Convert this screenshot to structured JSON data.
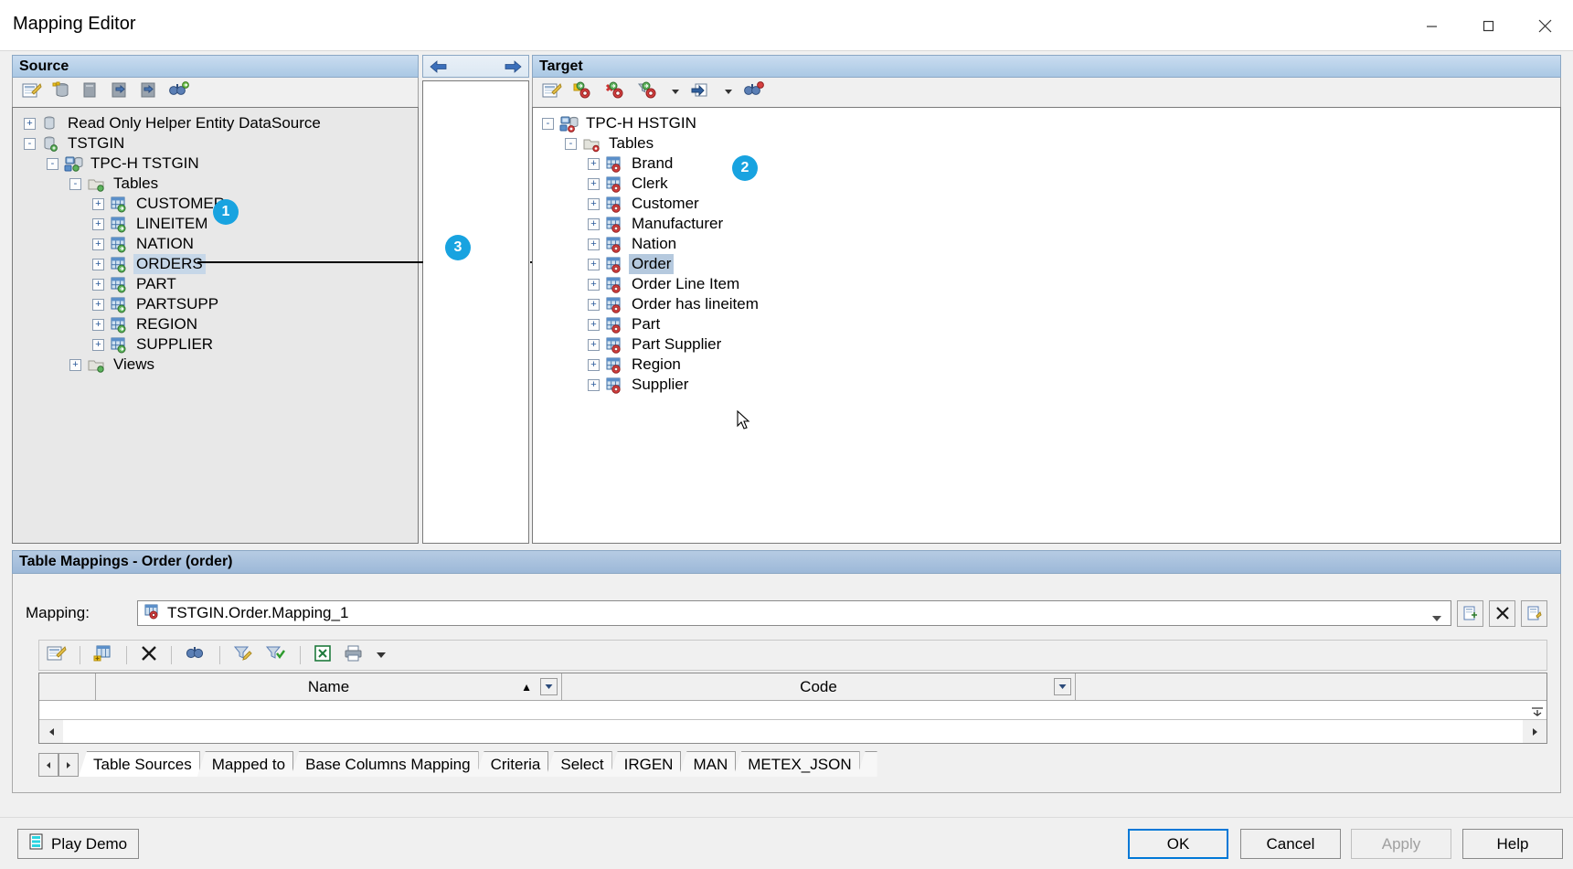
{
  "window": {
    "title": "Mapping Editor",
    "minimize_label": "Minimize",
    "maximize_label": "Maximize",
    "close_label": "Close"
  },
  "source": {
    "header": "Source",
    "badge": "1",
    "toolbar": [
      {
        "name": "open-editor-icon",
        "title": "Edit"
      },
      {
        "name": "add-datasource-icon",
        "title": "Add Data Source"
      },
      {
        "name": "copy-icon",
        "title": "Copy"
      },
      {
        "name": "import-icon",
        "title": "Import"
      },
      {
        "name": "export-icon",
        "title": "Export"
      },
      {
        "name": "find-icon",
        "title": "Find"
      }
    ],
    "tree": [
      {
        "label": "Read Only Helper Entity DataSource",
        "indent": 0,
        "expander": "+",
        "icon": "database-icon",
        "selected": false
      },
      {
        "label": "TSTGIN",
        "indent": 0,
        "expander": "-",
        "icon": "database-add-icon",
        "selected": false
      },
      {
        "label": "TPC-H TSTGIN",
        "indent": 1,
        "expander": "-",
        "icon": "connection-icon",
        "selected": false
      },
      {
        "label": "Tables",
        "indent": 2,
        "expander": "-",
        "icon": "folder-icon",
        "selected": false
      },
      {
        "label": "CUSTOMER",
        "indent": 3,
        "expander": "+",
        "icon": "table-green-icon",
        "selected": false
      },
      {
        "label": "LINEITEM",
        "indent": 3,
        "expander": "+",
        "icon": "table-green-icon",
        "selected": false
      },
      {
        "label": "NATION",
        "indent": 3,
        "expander": "+",
        "icon": "table-green-icon",
        "selected": false
      },
      {
        "label": "ORDERS",
        "indent": 3,
        "expander": "+",
        "icon": "table-green-icon",
        "selected": true
      },
      {
        "label": "PART",
        "indent": 3,
        "expander": "+",
        "icon": "table-green-icon",
        "selected": false
      },
      {
        "label": "PARTSUPP",
        "indent": 3,
        "expander": "+",
        "icon": "table-green-icon",
        "selected": false
      },
      {
        "label": "REGION",
        "indent": 3,
        "expander": "+",
        "icon": "table-green-icon",
        "selected": false
      },
      {
        "label": "SUPPLIER",
        "indent": 3,
        "expander": "+",
        "icon": "table-green-icon",
        "selected": false
      },
      {
        "label": "Views",
        "indent": 2,
        "expander": "+",
        "icon": "folder-icon",
        "selected": false
      }
    ]
  },
  "middle": {
    "badge": "3",
    "left_arrow_label": "Map left",
    "right_arrow_label": "Map right"
  },
  "target": {
    "header": "Target",
    "badge": "2",
    "toolbar": [
      {
        "name": "open-editor-icon",
        "title": "Edit"
      },
      {
        "name": "add-entity-icon",
        "title": "Add Entity"
      },
      {
        "name": "remove-entity-icon",
        "title": "Remove Entity"
      },
      {
        "name": "filter-entity-icon",
        "title": "Filter Entity"
      },
      {
        "name": "import-entity-icon",
        "title": "Import Entity"
      },
      {
        "name": "find-icon",
        "title": "Find"
      }
    ],
    "tree": [
      {
        "label": "TPC-H HSTGIN",
        "indent": 0,
        "expander": "-",
        "icon": "connection-red-icon",
        "selected": false
      },
      {
        "label": "Tables",
        "indent": 1,
        "expander": "-",
        "icon": "folder-red-icon",
        "selected": false
      },
      {
        "label": "Brand",
        "indent": 2,
        "expander": "+",
        "icon": "table-red-icon",
        "selected": false
      },
      {
        "label": "Clerk",
        "indent": 2,
        "expander": "+",
        "icon": "table-red-icon",
        "selected": false
      },
      {
        "label": "Customer",
        "indent": 2,
        "expander": "+",
        "icon": "table-red-icon",
        "selected": false
      },
      {
        "label": "Manufacturer",
        "indent": 2,
        "expander": "+",
        "icon": "table-red-icon",
        "selected": false
      },
      {
        "label": "Nation",
        "indent": 2,
        "expander": "+",
        "icon": "table-red-icon",
        "selected": false
      },
      {
        "label": "Order",
        "indent": 2,
        "expander": "+",
        "icon": "table-red-icon",
        "selected": true
      },
      {
        "label": "Order Line Item",
        "indent": 2,
        "expander": "+",
        "icon": "table-red-icon",
        "selected": false
      },
      {
        "label": "Order has lineitem",
        "indent": 2,
        "expander": "+",
        "icon": "table-red-icon",
        "selected": false
      },
      {
        "label": "Part",
        "indent": 2,
        "expander": "+",
        "icon": "table-red-icon",
        "selected": false
      },
      {
        "label": "Part Supplier",
        "indent": 2,
        "expander": "+",
        "icon": "table-red-icon",
        "selected": false
      },
      {
        "label": "Region",
        "indent": 2,
        "expander": "+",
        "icon": "table-red-icon",
        "selected": false
      },
      {
        "label": "Supplier",
        "indent": 2,
        "expander": "+",
        "icon": "table-red-icon",
        "selected": false
      }
    ]
  },
  "table_mappings": {
    "header": "Table Mappings - Order (order)",
    "mapping_label": "Mapping:",
    "mapping_value": "TSTGIN.Order.Mapping_1",
    "mapping_actions": [
      {
        "name": "new-mapping-button",
        "glyph": "new"
      },
      {
        "name": "delete-mapping-button",
        "glyph": "x"
      },
      {
        "name": "copy-mapping-button",
        "glyph": "copy"
      }
    ],
    "grid_toolbar": [
      {
        "name": "edit-row-icon",
        "title": "Edit"
      },
      {
        "name": "add-row-icon",
        "title": "Add"
      },
      {
        "name": "delete-row-icon",
        "title": "Delete"
      },
      {
        "name": "find-row-icon",
        "title": "Find"
      },
      {
        "name": "edit-filter-icon",
        "title": "Edit Filter"
      },
      {
        "name": "apply-filter-icon",
        "title": "Apply Filter"
      },
      {
        "name": "export-excel-icon",
        "title": "Export to Excel"
      },
      {
        "name": "print-icon",
        "title": "Print"
      }
    ],
    "columns": [
      {
        "label": "Name",
        "sort": "asc"
      },
      {
        "label": "Code",
        "sort": ""
      }
    ],
    "rows": [],
    "tabs": [
      {
        "label": "Table Sources",
        "active": true
      },
      {
        "label": "Mapped to",
        "active": false
      },
      {
        "label": "Base Columns Mapping",
        "active": false
      },
      {
        "label": "Criteria",
        "active": false
      },
      {
        "label": "Select",
        "active": false
      },
      {
        "label": "IRGEN",
        "active": false
      },
      {
        "label": "MAN",
        "active": false
      },
      {
        "label": "METEX_JSON",
        "active": false
      }
    ]
  },
  "footer": {
    "play_demo": "Play Demo",
    "ok": "OK",
    "cancel": "Cancel",
    "apply": "Apply",
    "help": "Help"
  },
  "colors": {
    "badge": "#18a3e0",
    "header_gradient_top": "#c9dcf0",
    "header_gradient_bottom": "#aac8e4",
    "default_button_border": "#0078d7",
    "selection_source": "#c6d7e8",
    "selection_target": "#b5c9de"
  }
}
